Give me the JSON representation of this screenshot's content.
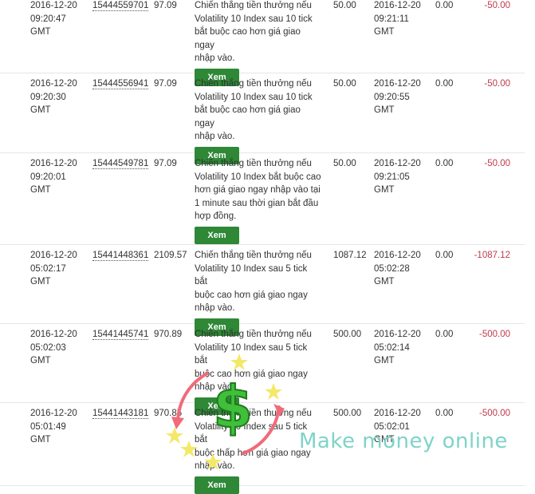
{
  "rows": [
    {
      "purchase_time": [
        "2016-12-20",
        "09:20:47",
        "GMT"
      ],
      "ref": "15444559701",
      "buy_price": "97.09",
      "description": [
        "Chiến thắng tiền thưởng nếu",
        "Volatility 10 Index sau 10 tick",
        "bắt buộc cao hơn giá giao ngay",
        "nhập vào."
      ],
      "sell_price": "50.00",
      "sell_time": [
        "2016-12-20",
        "09:21:11",
        "GMT"
      ],
      "profit": "0.00",
      "loss": "-50.00",
      "button": "Xem"
    },
    {
      "purchase_time": [
        "2016-12-20",
        "09:20:30",
        "GMT"
      ],
      "ref": "15444556941",
      "buy_price": "97.09",
      "description": [
        "Chiến thắng tiền thưởng nếu",
        "Volatility 10 Index sau 10 tick",
        "bắt buộc cao hơn giá giao ngay",
        "nhập vào."
      ],
      "sell_price": "50.00",
      "sell_time": [
        "2016-12-20",
        "09:20:55",
        "GMT"
      ],
      "profit": "0.00",
      "loss": "-50.00",
      "button": "Xem"
    },
    {
      "purchase_time": [
        "2016-12-20",
        "09:20:01",
        "GMT"
      ],
      "ref": "15444549781",
      "buy_price": "97.09",
      "description": [
        "Chiến thắng tiền thưởng nếu",
        "Volatility 10 Index bắt buộc cao",
        "hơn giá giao ngay nhập vào tại",
        "1 minute sau thời gian bắt đầu",
        "hợp đồng."
      ],
      "sell_price": "50.00",
      "sell_time": [
        "2016-12-20",
        "09:21:05",
        "GMT"
      ],
      "profit": "0.00",
      "loss": "-50.00",
      "button": "Xem"
    },
    {
      "purchase_time": [
        "2016-12-20",
        "05:02:17",
        "GMT"
      ],
      "ref": "15441448361",
      "buy_price": "2109.57",
      "description": [
        "Chiến thắng tiền thưởng nếu",
        "Volatility 10 Index sau 5 tick bắt",
        "buộc cao hơn giá giao ngay",
        "nhập vào."
      ],
      "sell_price": "1087.12",
      "sell_time": [
        "2016-12-20",
        "05:02:28",
        "GMT"
      ],
      "profit": "0.00",
      "loss": "-1087.12",
      "button": "Xem"
    },
    {
      "purchase_time": [
        "2016-12-20",
        "05:02:03",
        "GMT"
      ],
      "ref": "15441445741",
      "buy_price": "970.89",
      "description": [
        "Chiến thắng tiền thưởng nếu",
        "Volatility 10 Index sau 5 tick bắt",
        "buộc cao hơn giá giao ngay",
        "nhập vào."
      ],
      "sell_price": "500.00",
      "sell_time": [
        "2016-12-20",
        "05:02:14",
        "GMT"
      ],
      "profit": "0.00",
      "loss": "-500.00",
      "button": "Xem"
    },
    {
      "purchase_time": [
        "2016-12-20",
        "05:01:49",
        "GMT"
      ],
      "ref": "15441443181",
      "buy_price": "970.85",
      "description": [
        "Chiến thắng tiền thưởng nếu",
        "Volatility 10 Index sau 5 tick bắt",
        "buộc thấp hơn giá giao ngay",
        "nhập vào."
      ],
      "sell_price": "500.00",
      "sell_time": [
        "2016-12-20",
        "05:02:01",
        "GMT"
      ],
      "profit": "0.00",
      "loss": "-500.00",
      "button": "Xem"
    }
  ],
  "watermark": {
    "text": "Make money online",
    "icon": "dollar-sign-icon"
  },
  "colors": {
    "button": "#2e8836",
    "loss": "#c03a4a",
    "watermark": "#7fd3c8"
  }
}
